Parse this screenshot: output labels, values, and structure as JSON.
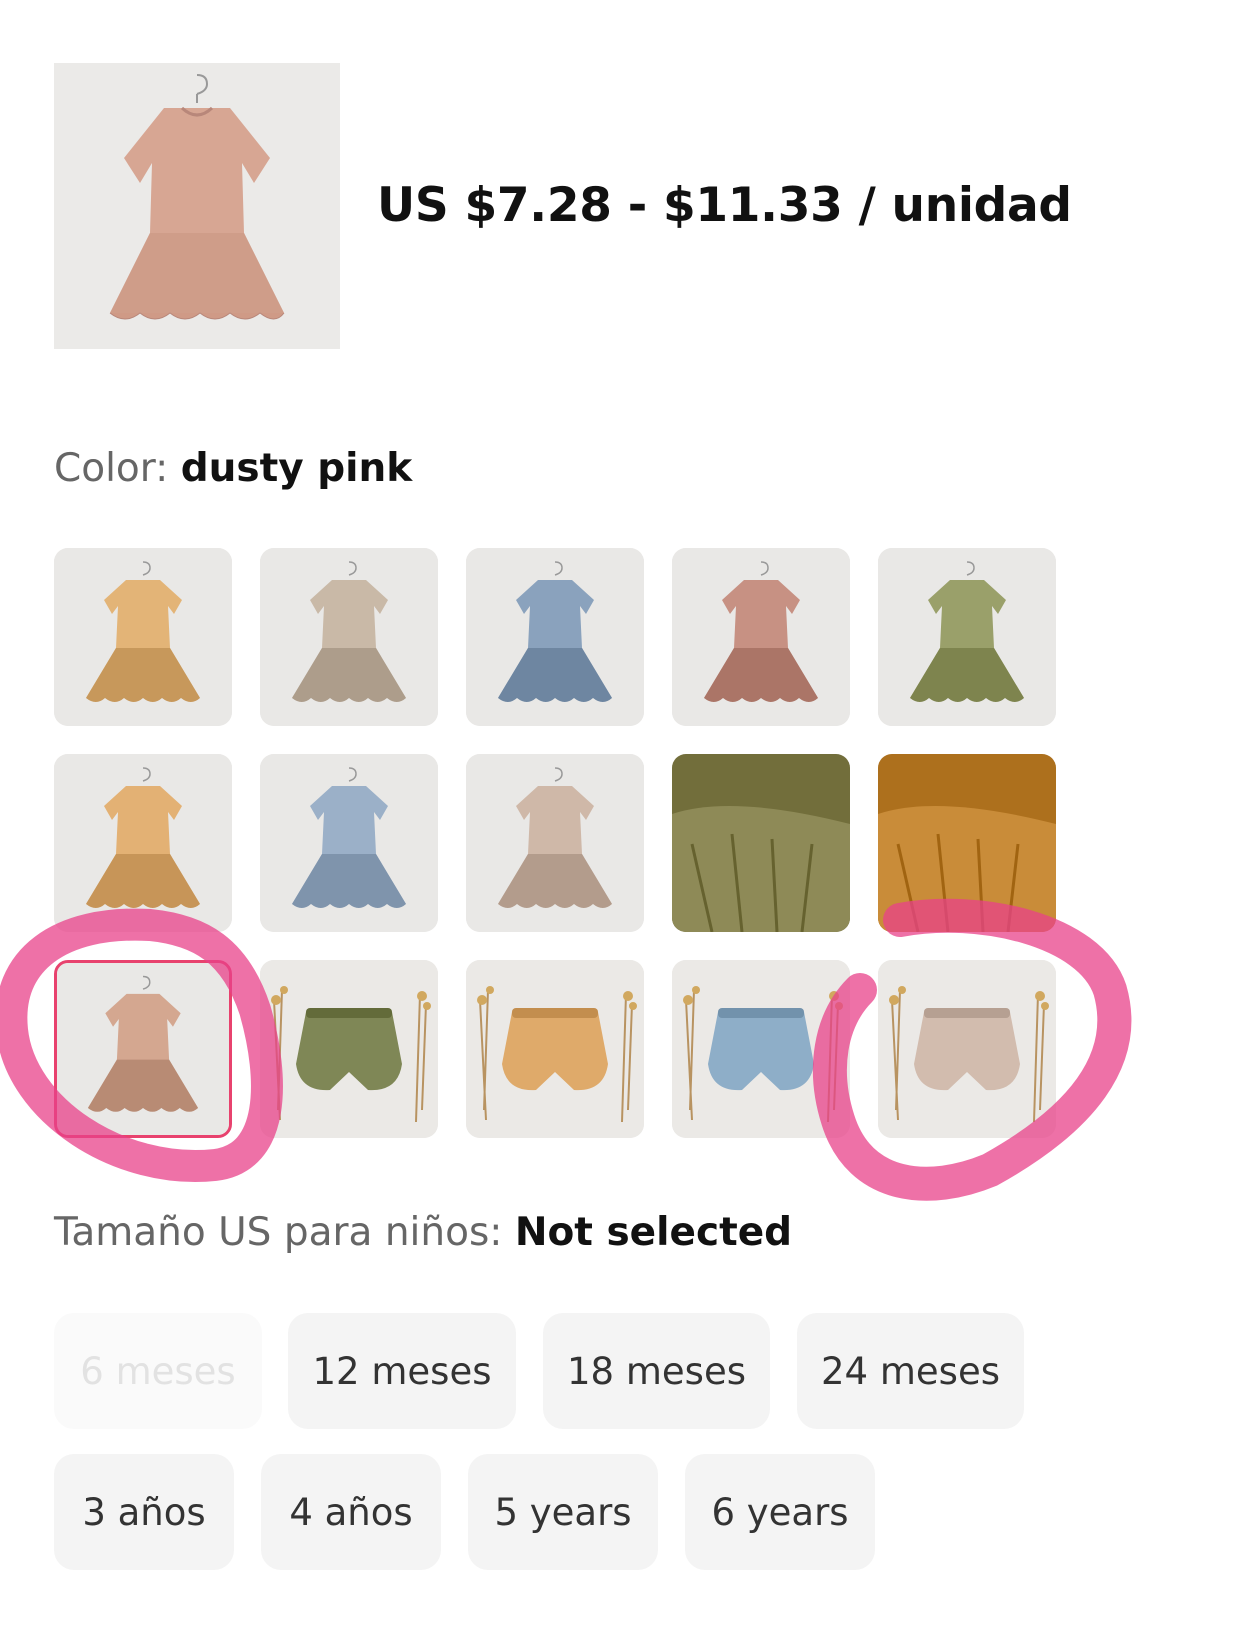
{
  "header": {
    "main_image": "product-dress-photo",
    "price": "US $7.28 - $11.33 / unidad"
  },
  "color": {
    "label": "Color:",
    "value": "dusty pink",
    "swatches": [
      {
        "item": "dress",
        "color": "#e3b477"
      },
      {
        "item": "dress",
        "color": "#c9b9a7"
      },
      {
        "item": "dress",
        "color": "#8aa2bd"
      },
      {
        "item": "dress",
        "color": "#c79183"
      },
      {
        "item": "dress",
        "color": "#9aa06a"
      },
      {
        "item": "dress",
        "color": "#e3b174"
      },
      {
        "item": "dress",
        "color": "#9bb0c8"
      },
      {
        "item": "dress",
        "color": "#cfb8a8"
      },
      {
        "item": "closeup",
        "color": "#8e8a57"
      },
      {
        "item": "closeup",
        "color": "#c98c39"
      },
      {
        "item": "dress",
        "color": "#d4a790",
        "selected": true
      },
      {
        "item": "bloomers",
        "color": "#7f8756"
      },
      {
        "item": "bloomers",
        "color": "#dfaa6a"
      },
      {
        "item": "bloomers",
        "color": "#8eaec8"
      },
      {
        "item": "bloomers",
        "color": "#d2bcae"
      }
    ]
  },
  "size": {
    "label": "Tamaño US para niños:",
    "value": "Not selected",
    "options": [
      {
        "label": "6 meses",
        "disabled": true
      },
      {
        "label": "12 meses"
      },
      {
        "label": "18 meses"
      },
      {
        "label": "24 meses"
      },
      {
        "label": "3 años"
      },
      {
        "label": "4 años"
      },
      {
        "label": "5 years"
      },
      {
        "label": "6 years"
      }
    ]
  },
  "colors": {
    "accent": "#e8426e",
    "annotation": "#e8428a"
  }
}
